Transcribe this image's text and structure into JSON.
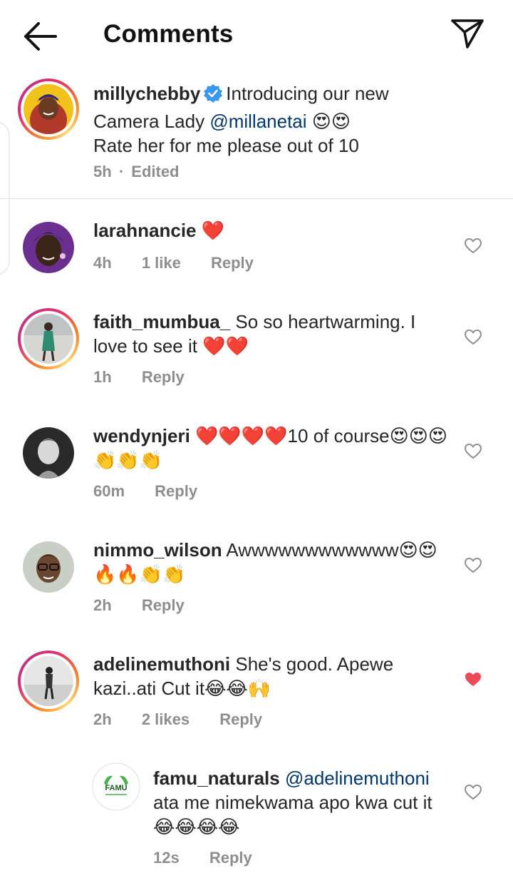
{
  "header": {
    "title": "Comments"
  },
  "caption": {
    "username": "millychebby",
    "text_before_mention": "Introducing our new Camera Lady ",
    "mention": "@millanetai",
    "line_end_emoji": "😍😍",
    "text_after": "Rate her for me please out of 10",
    "time": "5h",
    "separator": "·",
    "edited": "Edited"
  },
  "comments": [
    {
      "username": "larahnancie",
      "text": "❤️",
      "time": "4h",
      "likes": "1 like",
      "reply": "Reply",
      "liked": false
    },
    {
      "username": "faith_mumbua_",
      "text": "So so heartwarming. I love to see it ❤️❤️",
      "time": "1h",
      "likes": "",
      "reply": "Reply",
      "liked": false
    },
    {
      "username": "wendynjeri",
      "text": "❤️❤️❤️❤️10 of course😍😍😍👏👏👏",
      "time": "60m",
      "likes": "",
      "reply": "Reply",
      "liked": false
    },
    {
      "username": "nimmo_wilson",
      "text": "Awwwwwwwwwwww😍😍🔥🔥👏👏",
      "time": "2h",
      "likes": "",
      "reply": "Reply",
      "liked": false
    },
    {
      "username": "adelinemuthoni",
      "text": "She's good. Apewe kazi..ati Cut it😂😂🙌",
      "time": "2h",
      "likes": "2 likes",
      "reply": "Reply",
      "liked": true
    }
  ],
  "reply_comment": {
    "username": "famu_naturals",
    "mention": "@adelinemuthoni",
    "text": "ata me nimekwama apo kwa cut it😂😂😂😂",
    "time": "12s",
    "reply": "Reply",
    "avatar_logo_text": "FAMU",
    "liked": false
  },
  "colors": {
    "heart_liked": "#ed4956",
    "mention": "#00376b",
    "verified": "#3897f0",
    "meta": "#8e8e8e"
  },
  "icons": [
    "back-arrow-icon",
    "send-icon",
    "verified-badge-icon",
    "heart-outline-icon",
    "heart-filled-icon"
  ]
}
